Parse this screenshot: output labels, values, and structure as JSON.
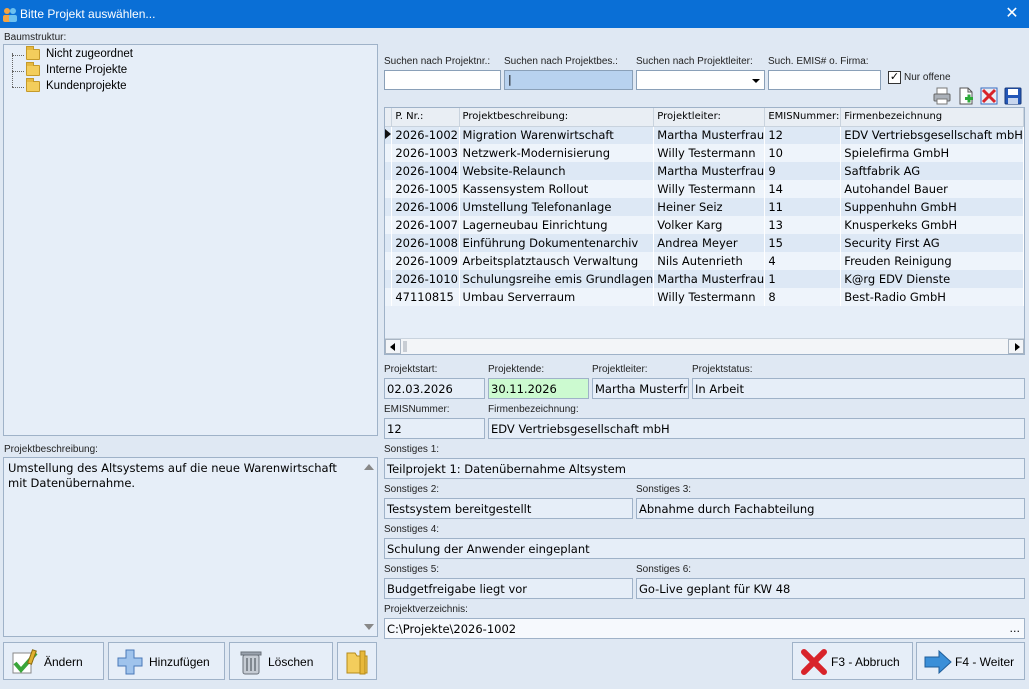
{
  "window": {
    "title": "Bitte Projekt auswählen...",
    "close_glyph": "✕"
  },
  "tree": {
    "label": "Baumstruktur:",
    "items": [
      {
        "label": "Nicht zugeordnet"
      },
      {
        "label": "Interne Projekte"
      },
      {
        "label": "Kundenprojekte"
      }
    ]
  },
  "search": {
    "nr_label": "Suchen nach Projektnr.:",
    "bes_label": "Suchen nach Projektbes.:",
    "leiter_label": "Suchen nach Projektleiter:",
    "emis_label": "Such. EMIS# o. Firma:",
    "nur_offene_label": "Nur offene",
    "nur_offene_checked": true,
    "check_glyph": "✓",
    "nr_value": "",
    "bes_value": "|",
    "leiter_value": "",
    "emis_value": ""
  },
  "grid": {
    "columns": [
      "P. Nr.:",
      "Projektbeschreibung:",
      "Projektleiter:",
      "EMISNummer:",
      "Firmenbezeichnung"
    ],
    "rows": [
      [
        "2026-1002",
        "Migration Warenwirtschaft",
        "Martha Musterfrau",
        "12",
        "EDV Vertriebsgesellschaft mbH"
      ],
      [
        "2026-1003",
        "Netzwerk-Modernisierung",
        "Willy Testermann",
        "10",
        "Spielefirma GmbH"
      ],
      [
        "2026-1004",
        "Website-Relaunch",
        "Martha Musterfrau",
        "9",
        "Saftfabrik AG"
      ],
      [
        "2026-1005",
        "Kassensystem Rollout",
        "Willy Testermann",
        "14",
        "Autohandel Bauer"
      ],
      [
        "2026-1006",
        "Umstellung Telefonanlage",
        "Heiner Seiz",
        "11",
        "Suppenhuhn GmbH"
      ],
      [
        "2026-1007",
        "Lagerneubau Einrichtung",
        "Volker Karg",
        "13",
        "Knusperkeks GmbH"
      ],
      [
        "2026-1008",
        "Einführung Dokumentenarchiv",
        "Andrea Meyer",
        "15",
        "Security First AG"
      ],
      [
        "2026-1009",
        "Arbeitsplatztausch Verwaltung",
        "Nils Autenrieth",
        "4",
        "Freuden Reinigung"
      ],
      [
        "2026-1010",
        "Schulungsreihe emis Grundlagen",
        "Martha Musterfrau",
        "1",
        "K@rg EDV Dienste"
      ],
      [
        "47110815",
        "Umbau Serverraum",
        "Willy Testermann",
        "8",
        "Best-Radio GmbH"
      ]
    ]
  },
  "details": {
    "projektstart_label": "Projektstart:",
    "projektstart": "02.03.2026",
    "projektende_label": "Projektende:",
    "projektende": "30.11.2026",
    "projektleiter_label": "Projektleiter:",
    "projektleiter": "Martha Musterfrau",
    "projektstatus_label": "Projektstatus:",
    "projektstatus": "In Arbeit",
    "emis_label": "EMISNummer:",
    "emis": "12",
    "firma_label": "Firmenbezeichnung:",
    "firma": "EDV Vertriebsgesellschaft mbH",
    "s1_label": "Sonstiges 1:",
    "s1": "Teilprojekt 1: Datenübernahme Altsystem",
    "s2_label": "Sonstiges 2:",
    "s2": "Testsystem bereitgestellt",
    "s3_label": "Sonstiges 3:",
    "s3": "Abnahme durch Fachabteilung",
    "s4_label": "Sonstiges 4:",
    "s4": "Schulung der Anwender eingeplant",
    "s5_label": "Sonstiges 5:",
    "s5": "Budgetfreigabe liegt vor",
    "s6_label": "Sonstiges 6:",
    "s6": "Go-Live geplant für KW 48",
    "verz_label": "Projektverzeichnis:",
    "verz": "C:\\Projekte\\2026-1002",
    "verz_button": "..."
  },
  "description": {
    "label": "Projektbeschreibung:",
    "text": "Umstellung des Altsystems auf die neue Warenwirtschaft mit Datenübernahme."
  },
  "buttons": {
    "aendern": "Ändern",
    "hinzufuegen": "Hinzufügen",
    "loeschen": "Löschen",
    "abbruch": "F3 - Abbruch",
    "weiter": "F4 - Weiter"
  }
}
